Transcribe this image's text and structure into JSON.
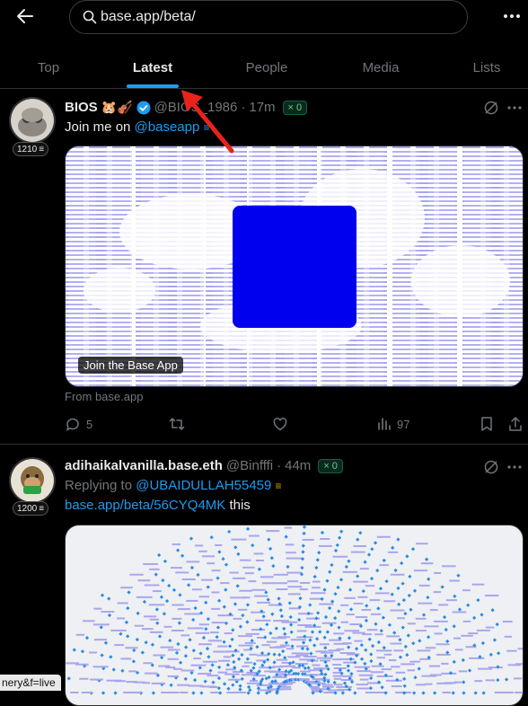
{
  "search": {
    "query": "base.app/beta/"
  },
  "tabs": [
    {
      "label": "Top"
    },
    {
      "label": "Latest"
    },
    {
      "label": "People"
    },
    {
      "label": "Media"
    },
    {
      "label": "Lists"
    }
  ],
  "post1": {
    "score": "1210",
    "name": "BIOS",
    "emoji": "🐹🎻",
    "handle": "@BIOS_1986",
    "time": "17m",
    "zero_badge": "× 0",
    "text_prefix": "Join me on ",
    "mention": "@baseapp",
    "card_label": "Join the Base App",
    "card_source": "From base.app",
    "replies": "5",
    "views": "97",
    "square_color": "#0000ee"
  },
  "post2": {
    "score": "1200",
    "name": "adihaikalvanilla.base.eth",
    "handle": "@Binfffi",
    "time": "44m",
    "zero_badge": "× 0",
    "replying_prefix": "Replying to ",
    "replying_to": "@UBAIDULLAH55459",
    "link": "base.app/beta/56CYQ4MK",
    "link_suffix": " this"
  },
  "status_url": "nery&f=live",
  "accent": "#1d9bf0",
  "annotation_arrow_color": "#e8231a"
}
